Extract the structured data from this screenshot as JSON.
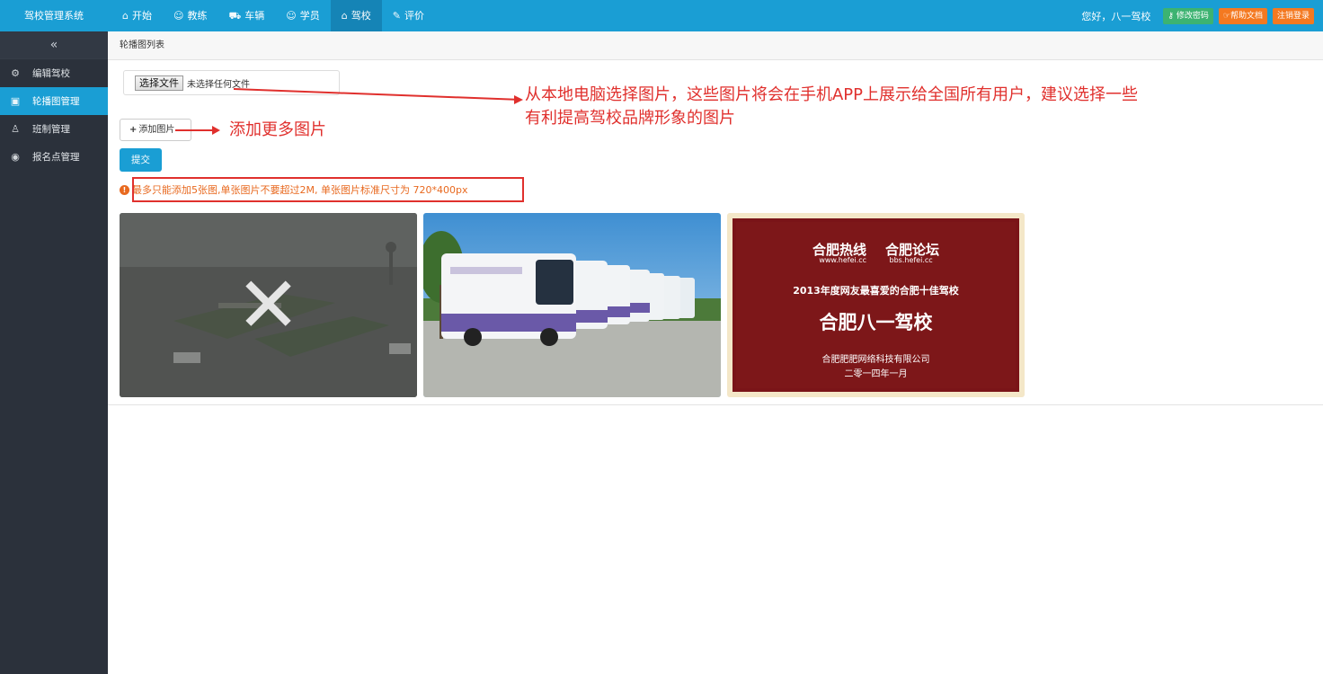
{
  "app": {
    "brand": "驾校管理系统"
  },
  "nav": {
    "items": [
      {
        "label": "开始",
        "icon": "home-icon"
      },
      {
        "label": "教练",
        "icon": "user-icon"
      },
      {
        "label": "车辆",
        "icon": "car-icon"
      },
      {
        "label": "学员",
        "icon": "student-icon"
      },
      {
        "label": "驾校",
        "icon": "school-icon",
        "active": true
      },
      {
        "label": "评价",
        "icon": "pen-icon"
      }
    ]
  },
  "topright": {
    "greeting": "您好，八一驾校",
    "change_password": "修改密码",
    "help_docs": "帮助文档",
    "logout": "注销登录"
  },
  "sidebar": {
    "items": [
      {
        "label": "编辑驾校",
        "icon": "gear-icon"
      },
      {
        "label": "轮播图管理",
        "icon": "image-icon",
        "active": true
      },
      {
        "label": "班制管理",
        "icon": "class-icon"
      },
      {
        "label": "报名点管理",
        "icon": "location-icon"
      }
    ]
  },
  "main": {
    "breadcrumb": "轮播图列表",
    "file_button": "选择文件",
    "file_status": "未选择任何文件",
    "add_button": "添加图片",
    "submit_button": "提交",
    "warning": "最多只能添加5张图,单张图片不要超过2M, 单张图片标准尺寸为 720*400px",
    "annotation_1": "从本地电脑选择图片，这些图片将会在手机APP上展示给全国所有用户，建议选择一些有利提高驾校品牌形象的图片",
    "annotation_2": "添加更多图片"
  },
  "images": [
    {
      "name": "training-ground-photo"
    },
    {
      "name": "bus-fleet-photo"
    },
    {
      "name": "award-plaque-photo",
      "logo_1": "合肥热线",
      "logo_1_url": "www.hefei.cc",
      "logo_2": "合肥论坛",
      "logo_2_url": "bbs.hefei.cc",
      "line_1": "2013年度网友最喜爱的合肥十佳驾校",
      "line_2": "合肥八一驾校",
      "line_3": "合肥肥肥网络科技有限公司",
      "line_4": "二零一四年一月"
    }
  ],
  "colors": {
    "primary": "#1a9ed4",
    "sidebar": "#2b313b",
    "warning": "#e8691f",
    "annotation": "#e0302d",
    "green": "#3cb371",
    "orange": "#f47920"
  }
}
